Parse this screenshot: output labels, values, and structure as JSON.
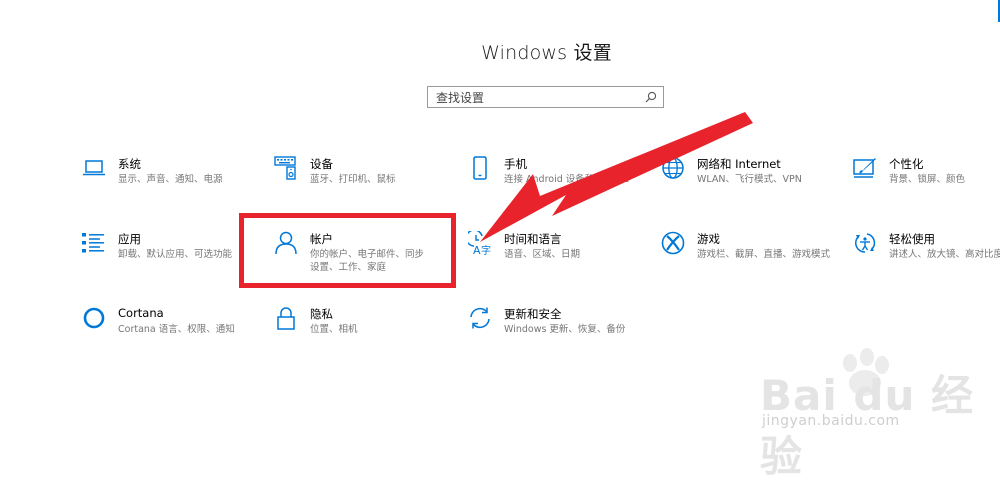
{
  "window": {
    "title": "Windows 设置"
  },
  "search": {
    "placeholder": "查找设置",
    "icon": "search-icon"
  },
  "accent_color": "#0078d7",
  "tiles": [
    {
      "name": "系统",
      "desc": "显示、声音、通知、电源",
      "icon": "laptop-icon"
    },
    {
      "name": "设备",
      "desc": "蓝牙、打印机、鼠标",
      "icon": "keyboard-speaker-icon"
    },
    {
      "name": "手机",
      "desc": "连接 Android 设备和 iPhone",
      "icon": "phone-icon"
    },
    {
      "name": "网络和 Internet",
      "desc": "WLAN、飞行模式、VPN",
      "icon": "globe-icon"
    },
    {
      "name": "个性化",
      "desc": "背景、锁屏、颜色",
      "icon": "paintbrush-screen-icon"
    },
    {
      "name": "应用",
      "desc": "卸载、默认应用、可选功能",
      "icon": "app-list-icon"
    },
    {
      "name": "帐户",
      "desc": "你的帐户、电子邮件、同步设置、工作、家庭",
      "icon": "person-icon"
    },
    {
      "name": "时间和语言",
      "desc": "语音、区域、日期",
      "icon": "clock-language-icon"
    },
    {
      "name": "游戏",
      "desc": "游戏栏、截屏、直播、游戏模式",
      "icon": "xbox-icon"
    },
    {
      "name": "轻松使用",
      "desc": "讲述人、放大镜、高对比度",
      "icon": "ease-of-access-icon"
    },
    {
      "name": "Cortana",
      "desc": "Cortana 语言、权限、通知",
      "icon": "cortana-ring-icon"
    },
    {
      "name": "隐私",
      "desc": "位置、相机",
      "icon": "lock-icon"
    },
    {
      "name": "更新和安全",
      "desc": "Windows 更新、恢复、备份",
      "icon": "sync-arrows-icon"
    }
  ],
  "annotation": {
    "highlight_color": "#e8232c",
    "arrow_color": "#e8232c"
  },
  "watermark": {
    "brand": "Bai du 经验",
    "url": "jingyan.baidu.com"
  }
}
